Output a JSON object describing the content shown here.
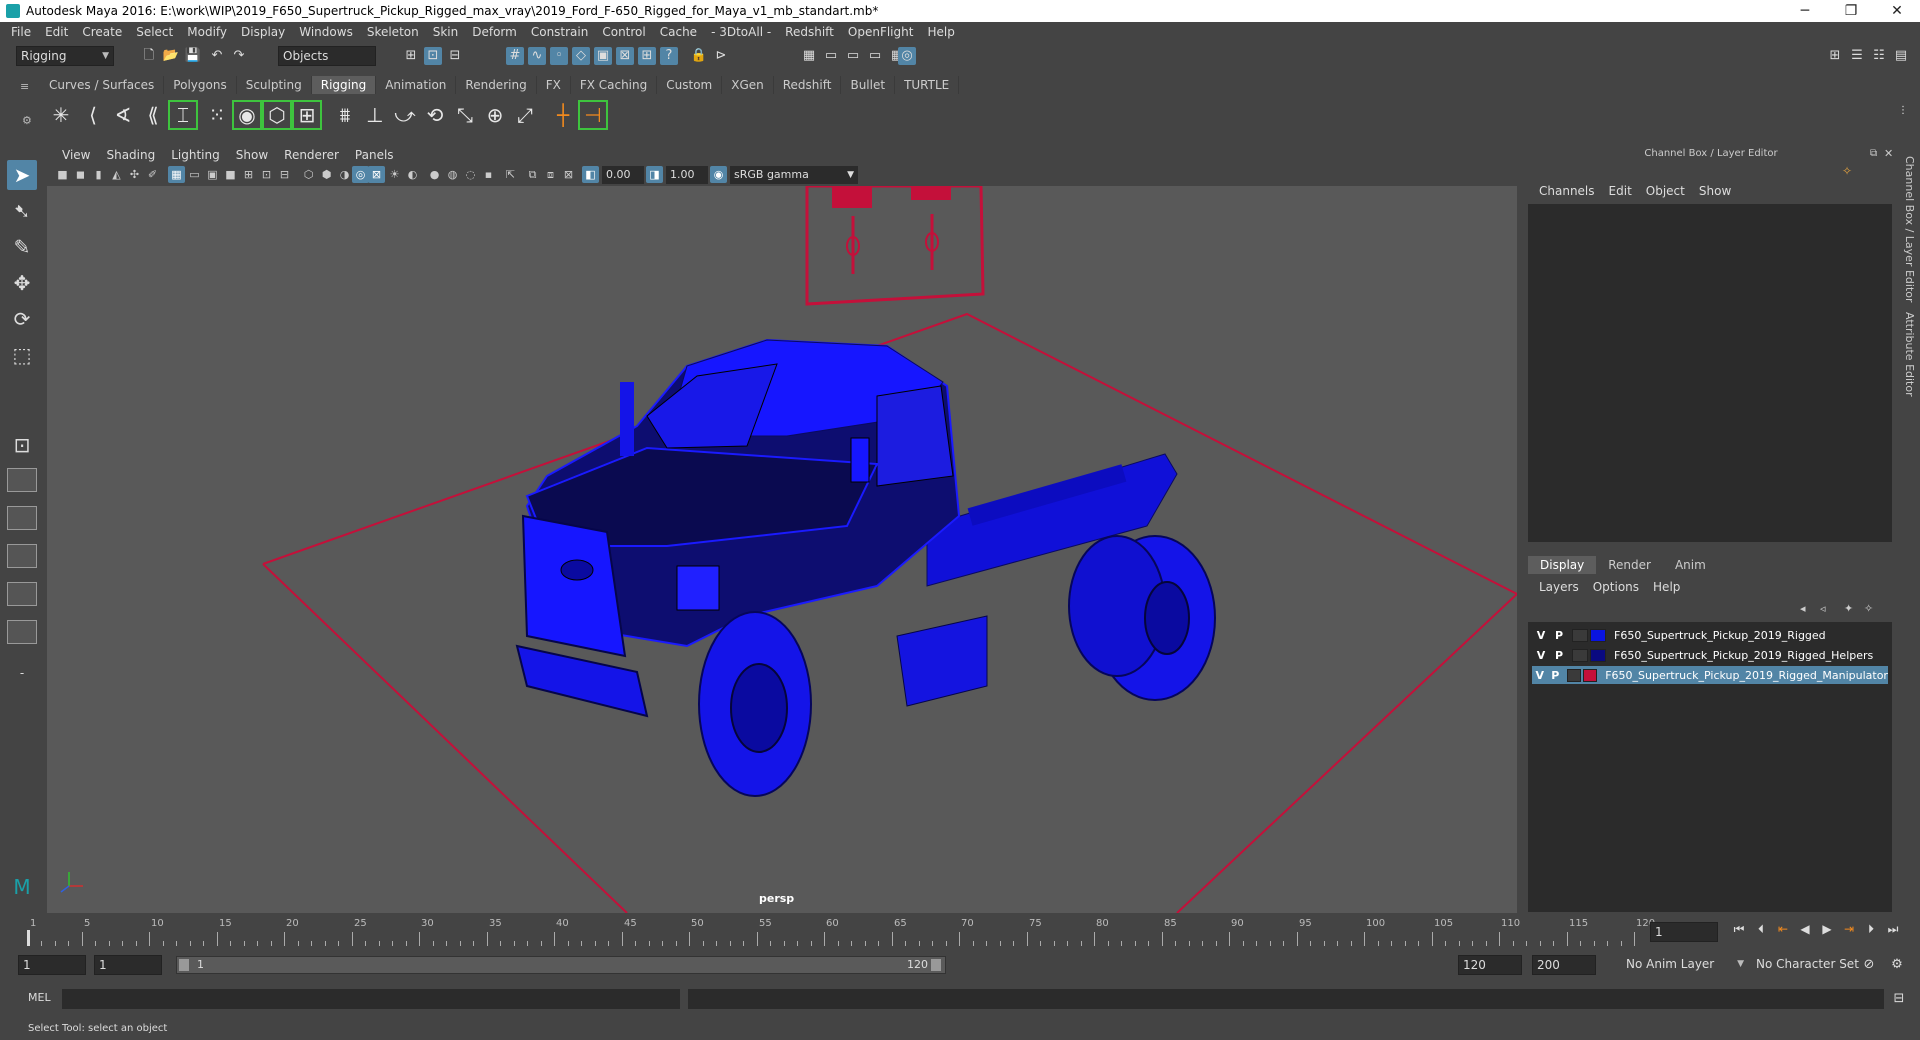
{
  "window": {
    "title": "Autodesk Maya 2016: E:\\work\\WIP\\2019_F650_Supertruck_Pickup_Rigged_max_vray\\2019_Ford_F-650_Rigged_for_Maya_v1_mb_standart.mb*",
    "minimize": "─",
    "restore": "❐",
    "close": "✕"
  },
  "menubar": [
    "File",
    "Edit",
    "Create",
    "Select",
    "Modify",
    "Display",
    "Windows",
    "Skeleton",
    "Skin",
    "Deform",
    "Constrain",
    "Control",
    "Cache",
    "- 3DtoAll -",
    "Redshift",
    "OpenFlight",
    "Help"
  ],
  "statusline": {
    "mode": "Rigging",
    "selection_mask": "Objects"
  },
  "shelf": {
    "tabs": [
      "Curves / Surfaces",
      "Polygons",
      "Sculpting",
      "Rigging",
      "Animation",
      "Rendering",
      "FX",
      "FX Caching",
      "Custom",
      "XGen",
      "Redshift",
      "Bullet",
      "TURTLE"
    ],
    "active_tab": "Rigging"
  },
  "viewport": {
    "menu": [
      "View",
      "Shading",
      "Lighting",
      "Show",
      "Renderer",
      "Panels"
    ],
    "exposure": "0.00",
    "gamma": "1.00",
    "color_space": "sRGB gamma",
    "camera": "persp"
  },
  "channel_box": {
    "title": "Channel Box / Layer Editor",
    "menu": [
      "Channels",
      "Edit",
      "Object",
      "Show"
    ]
  },
  "layer_editor": {
    "tabs": [
      "Display",
      "Render",
      "Anim"
    ],
    "active_tab": "Display",
    "menu": [
      "Layers",
      "Options",
      "Help"
    ],
    "layers": [
      {
        "v": "V",
        "p": "P",
        "color": "#0a14e0",
        "name": "F650_Supertruck_Pickup_2019_Rigged"
      },
      {
        "v": "V",
        "p": "P",
        "color": "#0a0a80",
        "name": "F650_Supertruck_Pickup_2019_Rigged_Helpers"
      },
      {
        "v": "V",
        "p": "P",
        "color": "#c4103a",
        "name": "F650_Supertruck_Pickup_2019_Rigged_Manipulator"
      }
    ]
  },
  "side_tabs": [
    "Channel Box / Layer Editor",
    "Attribute Editor"
  ],
  "timeslider": {
    "ticks": [
      "1",
      "5",
      "10",
      "15",
      "20",
      "25",
      "30",
      "35",
      "40",
      "45",
      "50",
      "55",
      "60",
      "65",
      "70",
      "75",
      "80",
      "85",
      "90",
      "95",
      "100",
      "105",
      "110",
      "115",
      "120"
    ],
    "current_frame": "1"
  },
  "range": {
    "start": "1",
    "playback_start": "1",
    "slider_start": "1",
    "slider_end": "120",
    "playback_end": "120",
    "end": "200",
    "anim_layer": "No Anim Layer",
    "character_set": "No Character Set"
  },
  "cmdline": {
    "lang": "MEL"
  },
  "helpline": "Select Tool: select an object"
}
